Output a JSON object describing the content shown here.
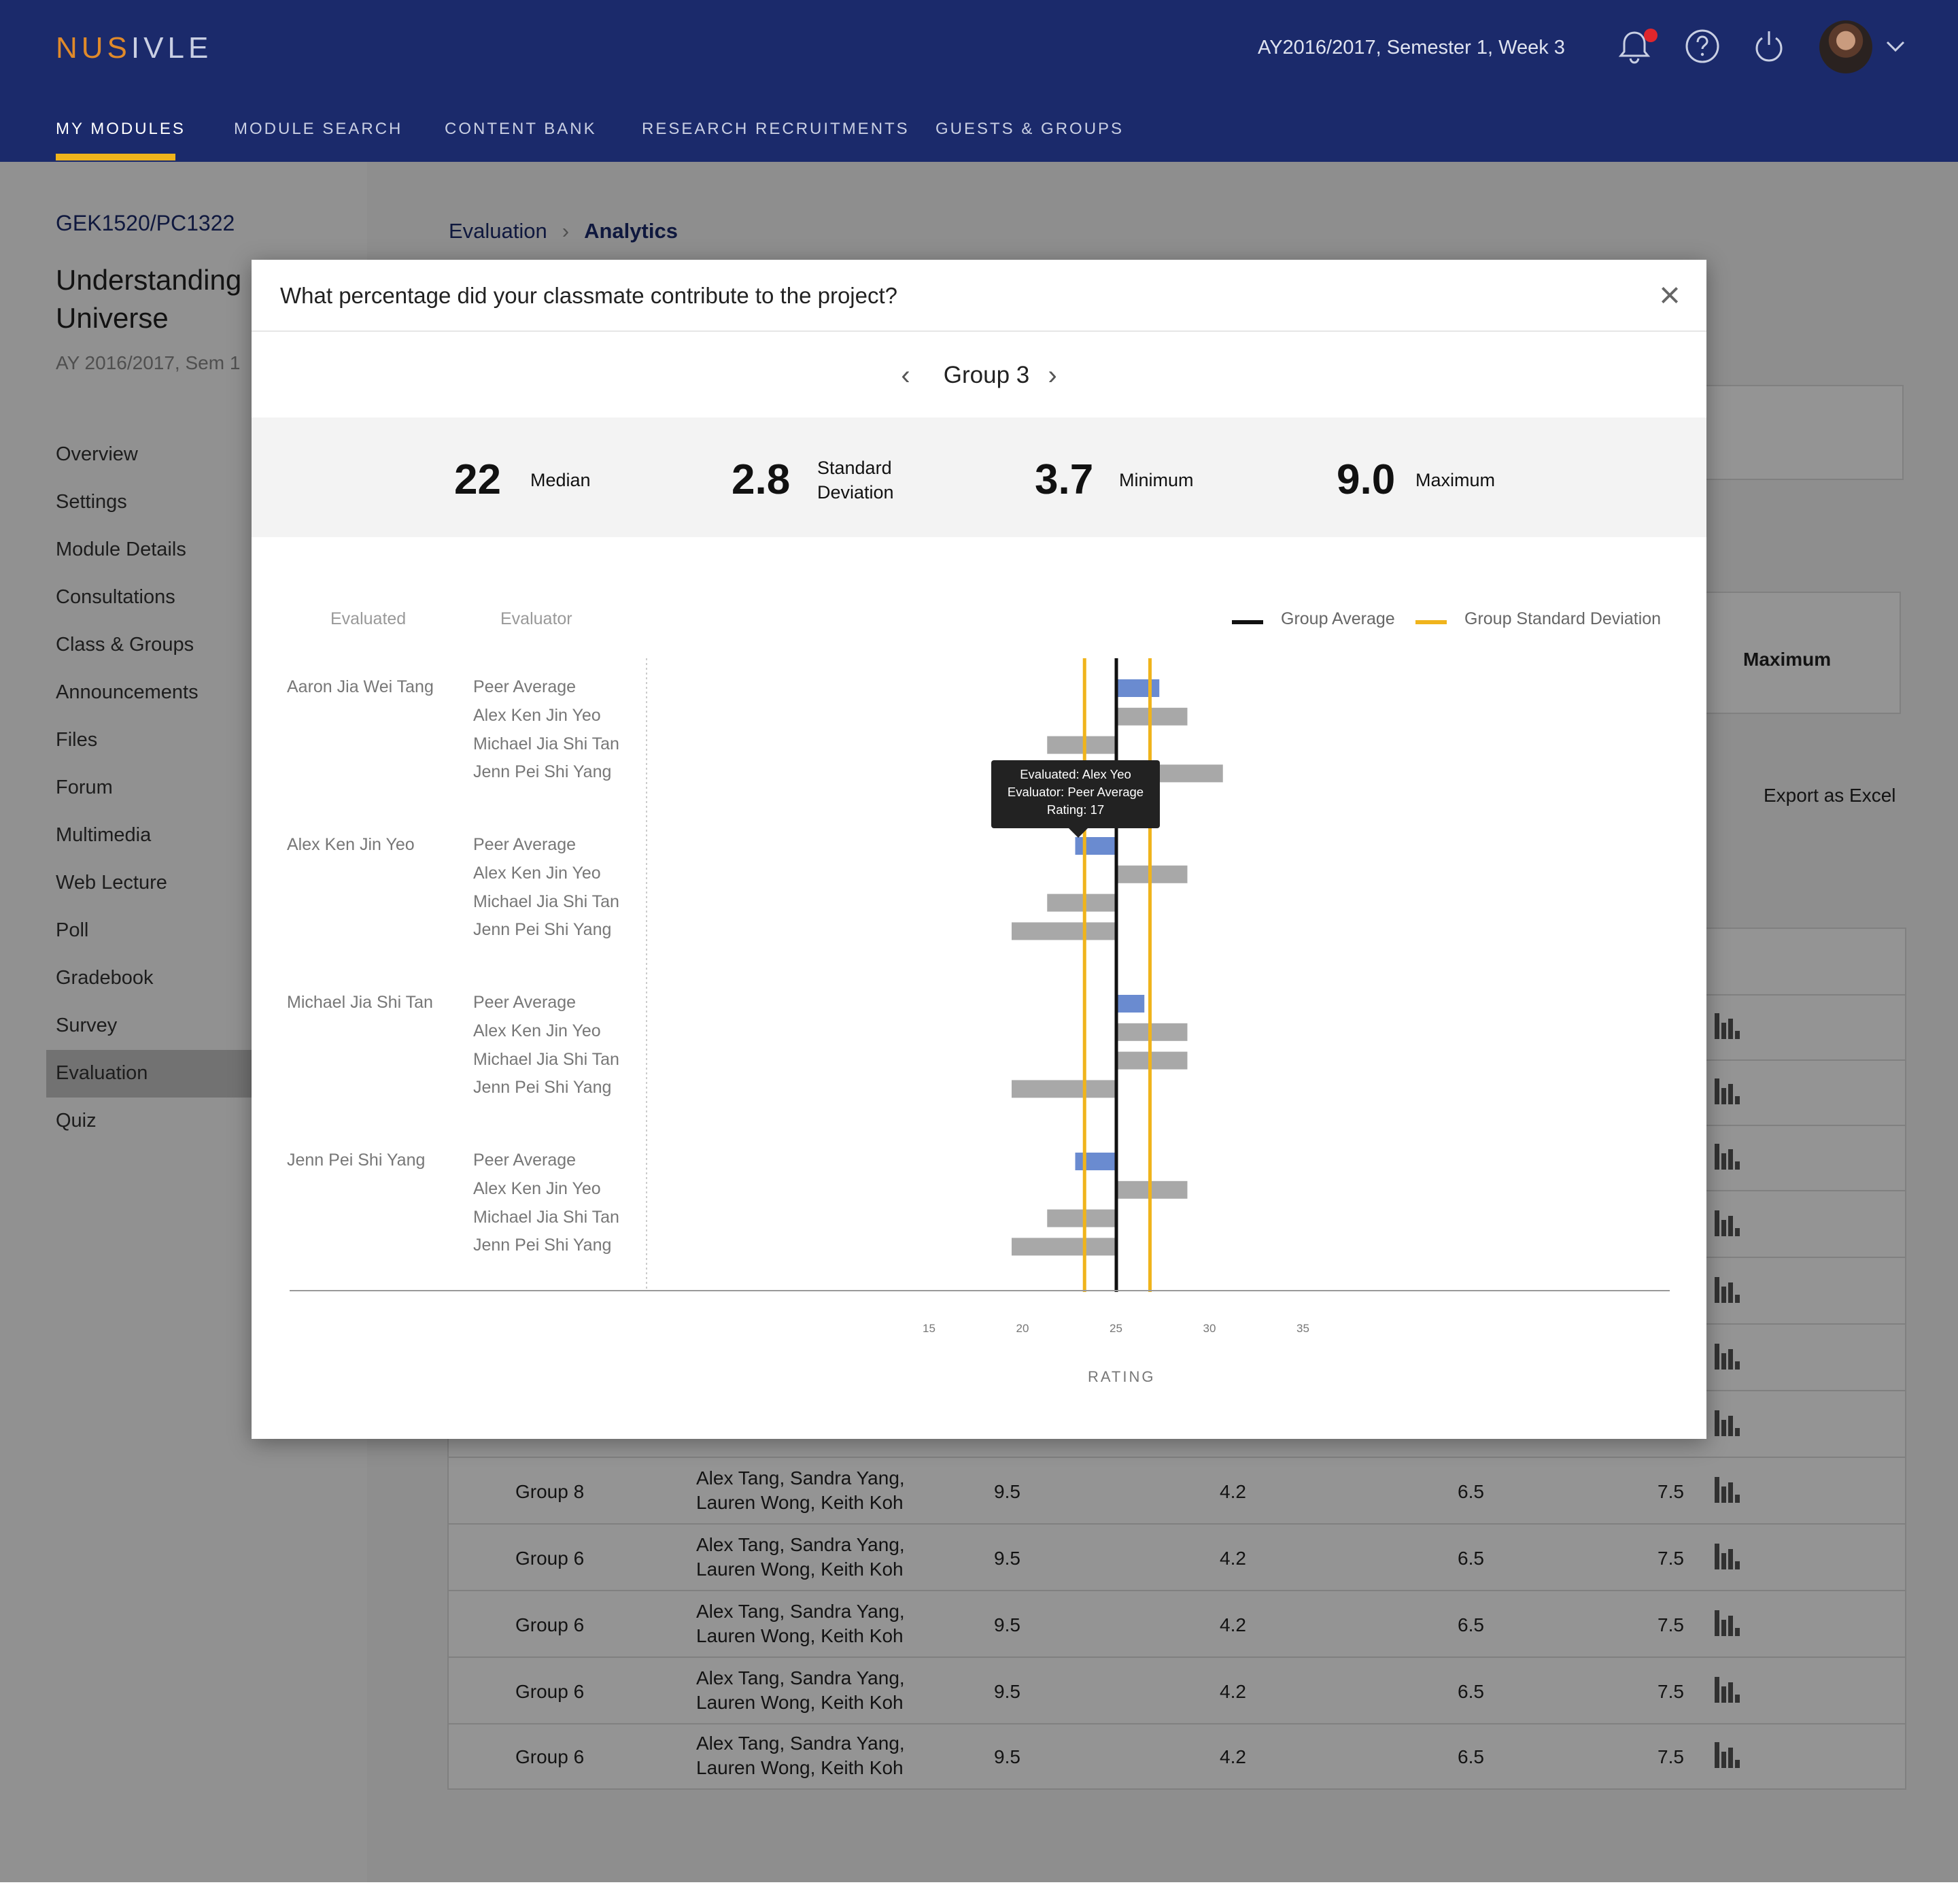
{
  "header": {
    "logo_a": "NUS",
    "logo_b": "IVLE",
    "term": "AY2016/2017, Semester 1, Week 3",
    "icons": [
      "bell-icon",
      "help-icon",
      "power-icon",
      "avatar",
      "chevron-down-icon"
    ],
    "nav": [
      "MY MODULES",
      "MODULE SEARCH",
      "CONTENT BANK",
      "RESEARCH RECRUITMENTS",
      "GUESTS & GROUPS"
    ],
    "active_nav": "MY MODULES",
    "colors": {
      "bar": "#1b2a6b",
      "accent": "#f0b41c",
      "notification": "#e0262c"
    }
  },
  "sidebar": {
    "module_code": "GEK1520/PC1322",
    "module_title_1": "Understanding",
    "module_title_2": "Universe",
    "semester": "AY 2016/2017, Sem 1",
    "items": [
      "Overview",
      "Settings",
      "Module Details",
      "Consultations",
      "Class & Groups",
      "Announcements",
      "Files",
      "Forum",
      "Multimedia",
      "Web Lecture",
      "Poll",
      "Gradebook",
      "Survey",
      "Evaluation",
      "Quiz"
    ],
    "active": "Evaluation"
  },
  "breadcrumb": {
    "parent": "Evaluation",
    "current": "Analytics"
  },
  "background": {
    "maximum_label": "Maximum",
    "export_label": "Export as Excel",
    "header_fragment": "n",
    "rows": [
      {
        "group": "Group 8",
        "members_1": "Alex Tang, Sandra Yang,",
        "members_2": "Lauren Wong, Keith Koh",
        "v1": "9.5",
        "v2": "4.2",
        "v3": "6.5",
        "v4": "7.5"
      },
      {
        "group": "Group 6",
        "members_1": "Alex Tang, Sandra Yang,",
        "members_2": "Lauren Wong, Keith Koh",
        "v1": "9.5",
        "v2": "4.2",
        "v3": "6.5",
        "v4": "7.5"
      },
      {
        "group": "Group 6",
        "members_1": "Alex Tang, Sandra Yang,",
        "members_2": "Lauren Wong, Keith Koh",
        "v1": "9.5",
        "v2": "4.2",
        "v3": "6.5",
        "v4": "7.5"
      },
      {
        "group": "Group 6",
        "members_1": "Alex Tang, Sandra Yang,",
        "members_2": "Lauren Wong, Keith Koh",
        "v1": "9.5",
        "v2": "4.2",
        "v3": "6.5",
        "v4": "7.5"
      },
      {
        "group": "Group 6",
        "members_1": "Alex Tang, Sandra Yang,",
        "members_2": "Lauren Wong, Keith Koh",
        "v1": "9.5",
        "v2": "4.2",
        "v3": "6.5",
        "v4": "7.5"
      }
    ]
  },
  "modal": {
    "title": "What percentage did your classmate contribute to the project?",
    "group": "Group 3",
    "stats": {
      "median_value": "22",
      "median_label": "Median",
      "sd_value": "2.8",
      "sd_label_1": "Standard",
      "sd_label_2": "Deviation",
      "min_value": "3.7",
      "min_label": "Minimum",
      "max_value": "9.0",
      "max_label": "Maximum"
    },
    "column_evaluated": "Evaluated",
    "column_evaluator": "Evaluator",
    "legend_average": "Group Average",
    "legend_sd": "Group Standard Deviation",
    "tooltip_1": "Evaluated: Alex Yeo",
    "tooltip_2": "Evaluator: Peer Average",
    "tooltip_3": "Rating: 17"
  },
  "chart_data": {
    "type": "bar",
    "orientation": "horizontal",
    "xlabel": "RATING",
    "x_ticks": [
      15,
      20,
      25,
      30,
      35
    ],
    "x_axis_origin": 25,
    "group_average": 25,
    "group_sd_lines": [
      23.3,
      26.8
    ],
    "colors": {
      "peer_average": "#6a8bd0",
      "evaluator": "#a8a8a8",
      "average_line": "#111111",
      "sd_line": "#f0b41c"
    },
    "groups": [
      {
        "evaluated": "Aaron Jia Wei Tang",
        "bars": [
          {
            "evaluator": "Peer Average",
            "value": 27.3
          },
          {
            "evaluator": "Alex Ken Jin Yeo",
            "value": 28.8
          },
          {
            "evaluator": "Michael Jia Shi Tan",
            "value": 21.3
          },
          {
            "evaluator": "Jenn Pei Shi Yang",
            "value": 30.7
          }
        ]
      },
      {
        "evaluated": "Alex Ken Jin Yeo",
        "bars": [
          {
            "evaluator": "Peer Average",
            "value": 22.8
          },
          {
            "evaluator": "Alex Ken Jin Yeo",
            "value": 28.8
          },
          {
            "evaluator": "Michael Jia Shi Tan",
            "value": 21.3
          },
          {
            "evaluator": "Jenn Pei Shi Yang",
            "value": 19.4
          }
        ]
      },
      {
        "evaluated": "Michael Jia Shi Tan",
        "bars": [
          {
            "evaluator": "Peer Average",
            "value": 26.5
          },
          {
            "evaluator": "Alex Ken Jin Yeo",
            "value": 28.8
          },
          {
            "evaluator": "Michael Jia Shi Tan",
            "value": 28.8
          },
          {
            "evaluator": "Jenn Pei Shi Yang",
            "value": 19.4
          }
        ]
      },
      {
        "evaluated": "Jenn Pei Shi Yang",
        "bars": [
          {
            "evaluator": "Peer Average",
            "value": 22.8
          },
          {
            "evaluator": "Alex Ken Jin Yeo",
            "value": 28.8
          },
          {
            "evaluator": "Michael Jia Shi Tan",
            "value": 21.3
          },
          {
            "evaluator": "Jenn Pei Shi Yang",
            "value": 19.4
          }
        ]
      }
    ]
  }
}
